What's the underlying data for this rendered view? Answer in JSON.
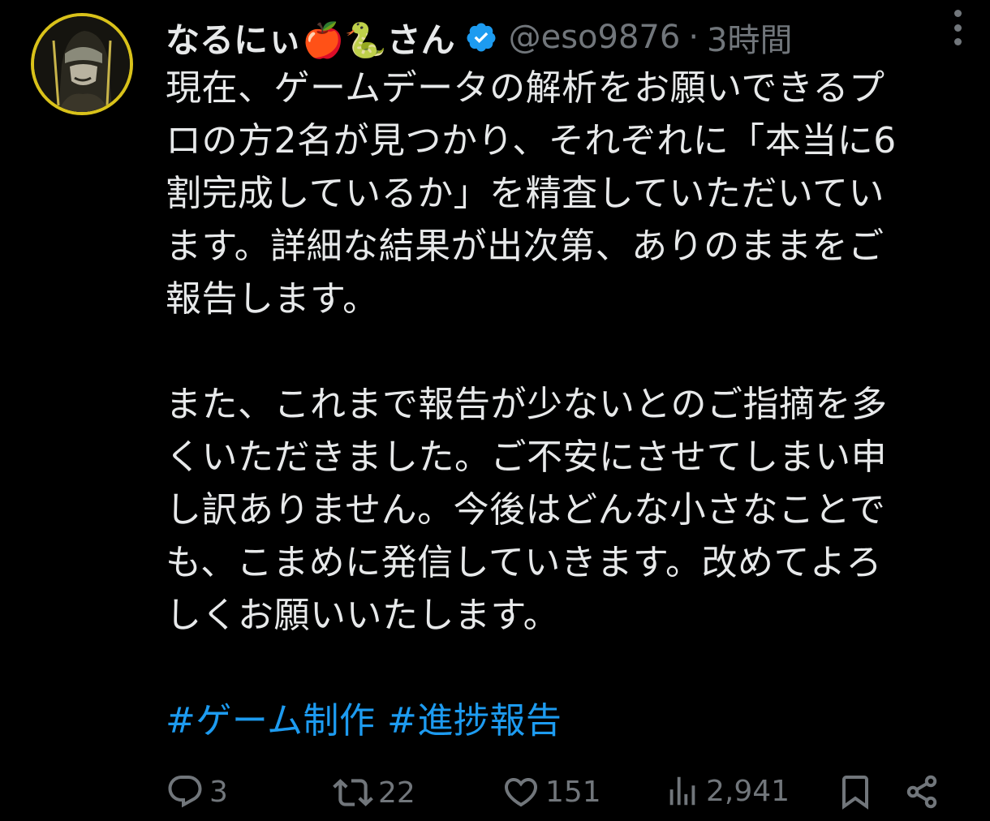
{
  "author": {
    "display_name": "なるにぃ🍎🐍さん",
    "handle": "@eso9876",
    "separator": "·",
    "time": "3時間",
    "verified": true
  },
  "tweet": {
    "paragraph1": "現在、ゲームデータの解析をお願いできるプ\nロの方2名が見つかり、それぞれに「本当に6\n割完成しているか」を精査していただいてい\nます。詳細な結果が出次第、ありのままをご\n報告します。",
    "paragraph2": "また、これまで報告が少ないとのご指摘を多\nくいただきました。ご不安にさせてしまい申\nし訳ありません。今後はどんな小さなことで\nも、こまめに発信していきます。改めてよろ\nしくお願いいたします。",
    "hashtags": [
      "#ゲーム制作",
      "#進捗報告"
    ]
  },
  "actions": {
    "replies": "3",
    "retweets": "22",
    "likes": "151",
    "views": "2,941"
  },
  "icons": {
    "reply": "reply-icon",
    "retweet": "retweet-icon",
    "like": "heart-icon",
    "views": "views-icon",
    "bookmark": "bookmark-icon",
    "share": "share-icon",
    "more": "more-icon",
    "verified": "verified-badge-icon"
  },
  "colors": {
    "background": "#000000",
    "text": "#e7e9ea",
    "muted": "#71767b",
    "link": "#1d9bf0",
    "verified": "#1d9bf0",
    "avatar_ring": "#d9c21a"
  }
}
